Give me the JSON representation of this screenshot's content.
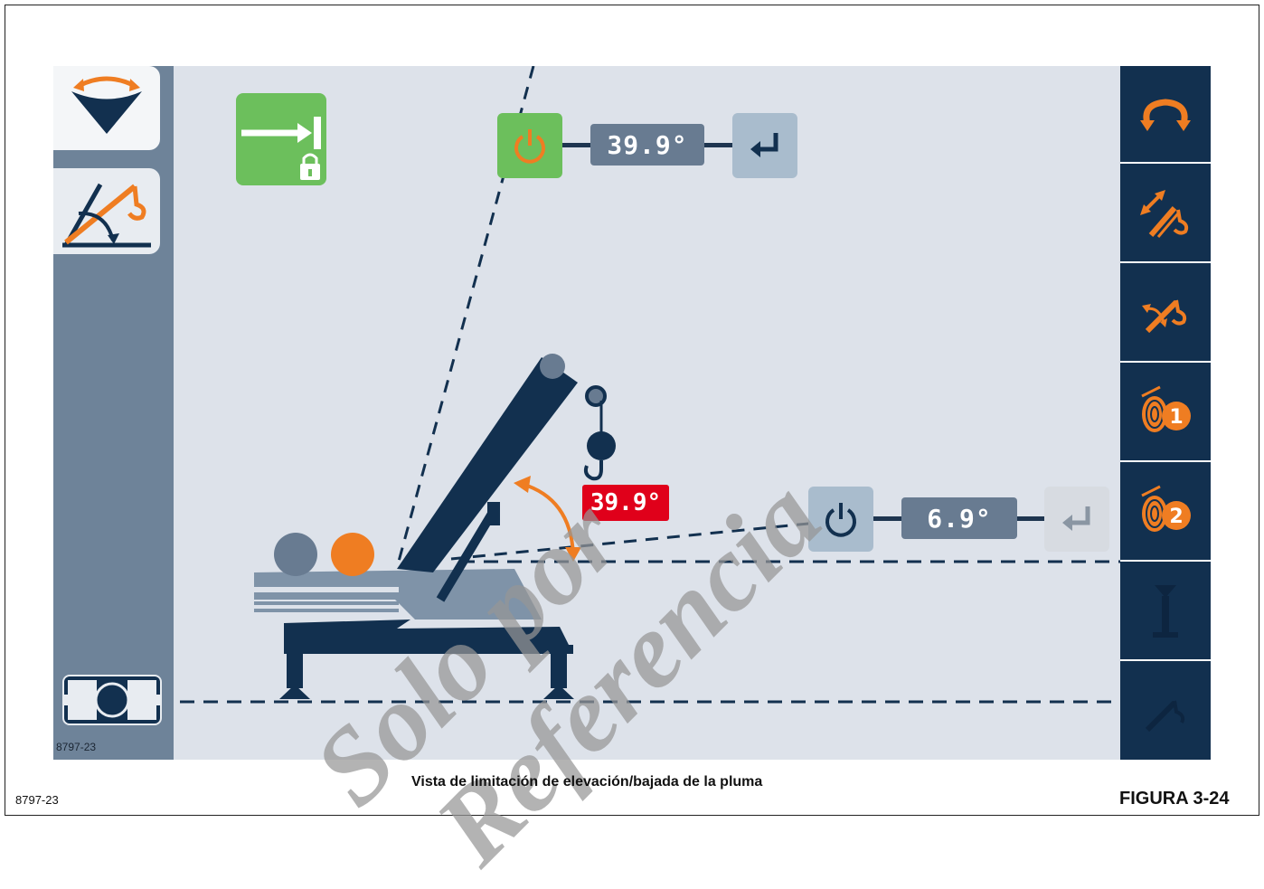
{
  "screen": {
    "left_tabs": [
      {
        "icon": "swing-view-icon",
        "active": true
      },
      {
        "icon": "boom-angle-limit-icon",
        "active": false
      }
    ],
    "left_code": "8797-23",
    "right_buttons": [
      {
        "icon": "swing-limit-icon"
      },
      {
        "icon": "telescope-limit-icon"
      },
      {
        "icon": "boom-elevation-limit-icon"
      },
      {
        "icon": "winch-1-icon",
        "number": "1"
      },
      {
        "icon": "winch-2-icon",
        "number": "2"
      },
      {
        "icon": "height-limit-icon"
      },
      {
        "icon": "radius-limit-icon"
      }
    ],
    "upper_limit": {
      "value": "39.9°",
      "power_state": "on",
      "enter": "enter-icon"
    },
    "lower_limit": {
      "value": "6.9°",
      "power_state": "off",
      "enter": "enter-icon"
    },
    "current_angle": "39.9°",
    "wall_lock_badge": "wall-lock-icon",
    "colors": {
      "accent_orange": "#ef7d22",
      "alert_red": "#e0001a",
      "active_green": "#6cbf5c",
      "navy": "#12304f",
      "slate": "#687b91"
    }
  },
  "caption": "Vista de limitación de elevación/bajada de la pluma",
  "bottom_code": "8797-23",
  "figure_label": "FIGURA 3-24",
  "watermark": {
    "line1": "Solo por",
    "line2": "Referencia"
  }
}
